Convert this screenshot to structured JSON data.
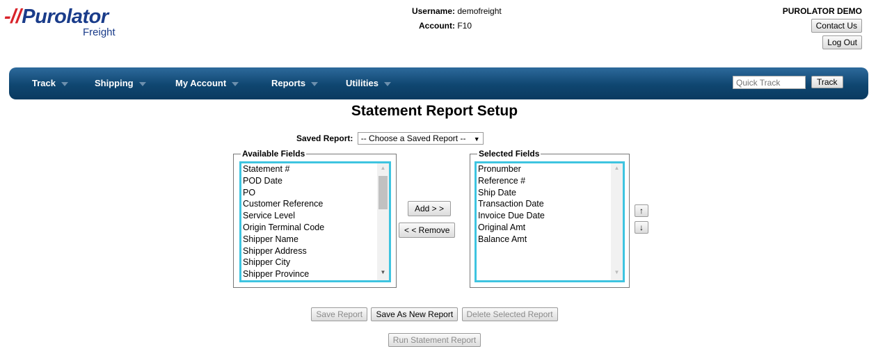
{
  "logo": {
    "main": "Purolator",
    "sub": "Freight"
  },
  "user": {
    "username_label": "Username:",
    "username": "demofreight",
    "account_label": "Account:",
    "account": "F10"
  },
  "company": "PUROLATOR DEMO",
  "header_buttons": {
    "contact": "Contact Us",
    "logout": "Log Out"
  },
  "nav": [
    {
      "label": "Track"
    },
    {
      "label": "Shipping"
    },
    {
      "label": "My Account"
    },
    {
      "label": "Reports"
    },
    {
      "label": "Utilities"
    }
  ],
  "quick_track": {
    "placeholder": "Quick Track",
    "button": "Track"
  },
  "page_title": "Statement Report Setup",
  "saved_report": {
    "label": "Saved Report:",
    "selected": "-- Choose a Saved Report --"
  },
  "available": {
    "legend": "Available Fields",
    "items": [
      "Statement #",
      "POD Date",
      "PO",
      "Customer Reference",
      "Service Level",
      "Origin Terminal Code",
      "Shipper Name",
      "Shipper Address",
      "Shipper City",
      "Shipper Province"
    ]
  },
  "selected": {
    "legend": "Selected Fields",
    "items": [
      "Pronumber",
      "Reference #",
      "Ship Date",
      "Transaction Date",
      "Invoice Due Date",
      "Original Amt",
      "Balance Amt"
    ]
  },
  "transfer": {
    "add": "Add > >",
    "remove": "< < Remove"
  },
  "order": {
    "up": "↑",
    "down": "↓"
  },
  "actions": {
    "save": "Save Report",
    "save_new": "Save As New Report",
    "delete": "Delete Selected Report",
    "run": "Run Statement Report"
  },
  "colors": {
    "nav": "#0f4670",
    "brand_blue": "#1a3c8a",
    "brand_red": "#d8232a",
    "listbox_border": "#3ec4e0"
  }
}
